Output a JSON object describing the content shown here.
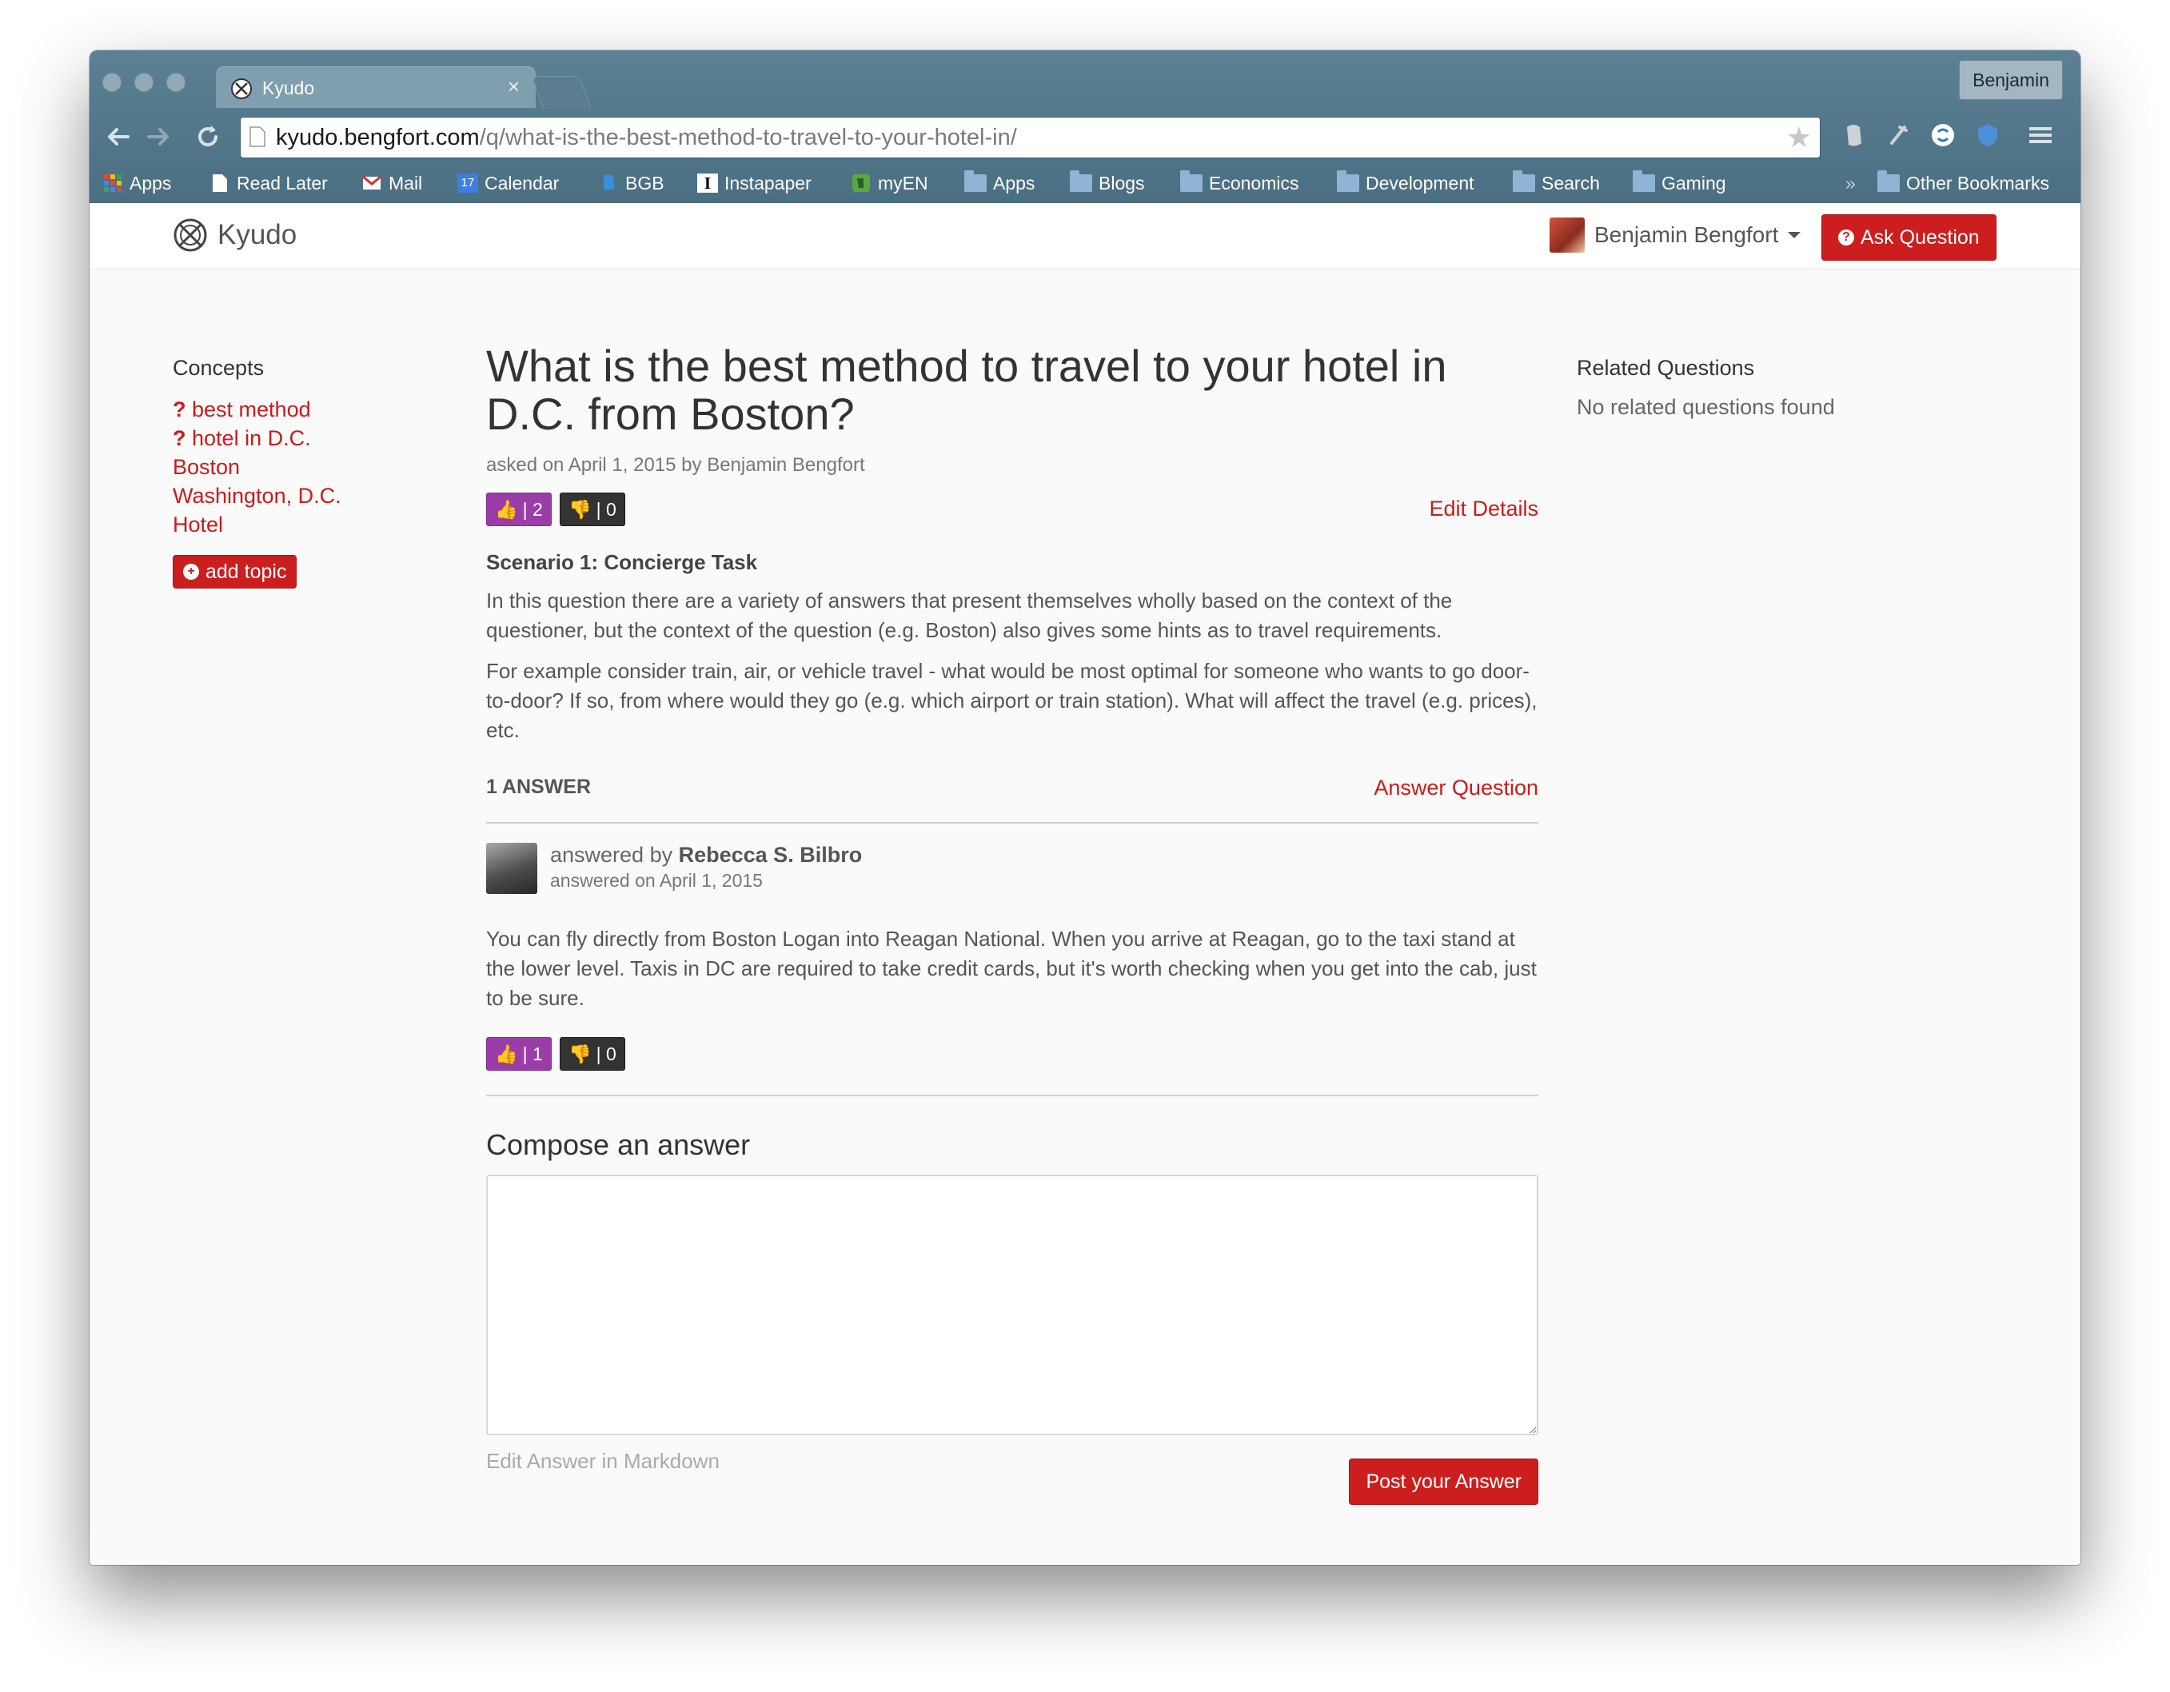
{
  "browser": {
    "tab_title": "Kyudo",
    "tab_close": "×",
    "profile_name": "Benjamin",
    "url_host": "kyudo.bengfort.com",
    "url_path": "/q/what-is-the-best-method-to-travel-to-your-hotel-in/",
    "bookmarks": [
      {
        "label": "Apps",
        "icon": "apps-grid-icon"
      },
      {
        "label": "Read Later",
        "icon": "page-icon"
      },
      {
        "label": "Mail",
        "icon": "gmail-icon"
      },
      {
        "label": "Calendar",
        "icon": "calendar-icon",
        "badge": "17"
      },
      {
        "label": "BGB",
        "icon": "bgb-icon"
      },
      {
        "label": "Instapaper",
        "icon": "instapaper-icon",
        "badge": "I"
      },
      {
        "label": "myEN",
        "icon": "evernote-icon"
      },
      {
        "label": "Apps",
        "icon": "folder-icon"
      },
      {
        "label": "Blogs",
        "icon": "folder-icon"
      },
      {
        "label": "Economics",
        "icon": "folder-icon"
      },
      {
        "label": "Development",
        "icon": "folder-icon"
      },
      {
        "label": "Search",
        "icon": "folder-icon"
      },
      {
        "label": "Gaming",
        "icon": "folder-icon"
      }
    ],
    "bookmarks_overflow": "»",
    "other_bookmarks": "Other Bookmarks"
  },
  "navbar": {
    "brand": "Kyudo",
    "user_name": "Benjamin Bengfort",
    "ask_button": "Ask Question"
  },
  "concepts": {
    "title": "Concepts",
    "items": [
      {
        "label": "best method",
        "prefix": "?"
      },
      {
        "label": "hotel in D.C.",
        "prefix": "?"
      },
      {
        "label": "Boston",
        "prefix": ""
      },
      {
        "label": "Washington, D.C.",
        "prefix": ""
      },
      {
        "label": "Hotel",
        "prefix": ""
      }
    ],
    "add_topic": "add topic"
  },
  "question": {
    "title": "What is the best method to travel to your hotel in D.C. from Boston?",
    "asked_meta": "asked on April 1, 2015 by Benjamin Bengfort",
    "upvotes": "| 2",
    "downvotes": "| 0",
    "edit_link": "Edit Details",
    "scenario": "Scenario 1: Concierge Task",
    "paragraphs": [
      "In this question there are a variety of answers that present themselves wholly based on the context of the questioner, but the context of the question (e.g. Boston) also gives some hints as to travel requirements.",
      "For example consider train, air, or vehicle travel - what would be most optimal for someone who wants to go door-to-door? If so, from where would they go (e.g. which airport or train station). What will affect the travel (e.g. prices), etc."
    ]
  },
  "answers": {
    "count_label": "1 ANSWER",
    "answer_link": "Answer Question",
    "items": [
      {
        "by_prefix": "answered by",
        "author": "Rebecca S. Bilbro",
        "date": "answered on April 1, 2015",
        "body": "You can fly directly from Boston Logan into Reagan National. When you arrive at Reagan, go to the taxi stand at the lower level. Taxis in DC are required to take credit cards, but it's worth checking when you get into the cab, just to be sure.",
        "upvotes": "| 1",
        "downvotes": "| 0"
      }
    ]
  },
  "compose": {
    "title": "Compose an answer",
    "textarea_value": "",
    "markdown_hint": "Edit Answer in Markdown",
    "post_button": "Post your Answer"
  },
  "related": {
    "title": "Related Questions",
    "empty": "No related questions found"
  },
  "colors": {
    "accent_red": "#cc1e1e",
    "upvote_purple": "#9b3da8",
    "downvote_dark": "#333333",
    "chrome_blue": "#5d8194"
  }
}
